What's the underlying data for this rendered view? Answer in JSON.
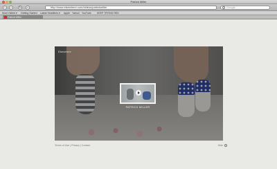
{
  "window": {
    "title": "Patrick Miller"
  },
  "toolbar": {
    "url": "http://www.elsewhere.com/videos/patrickmiller",
    "search_placeholder": "Google",
    "back": "‹",
    "forward": "›",
    "reload": "↻",
    "home": "⌂"
  },
  "bookmarks": {
    "items": [
      "Most Visited ▾",
      "Getting Started",
      "Latest Headlines ▾",
      "Apple",
      "Yahoo!",
      "YouTube",
      "KEEP TRYING RED"
    ]
  },
  "tab": {
    "label": "Patrick Miller"
  },
  "player": {
    "logo": "Elsewhere",
    "caption": "PATRICK MILLER"
  },
  "footer": {
    "links": [
      "Terms of Use",
      "Privacy",
      "Contact"
    ],
    "right": "Hide"
  },
  "colors": {
    "sock_blue": "#24388c",
    "sock_grey": "#585a5e",
    "page_bg": "#e9e9e6"
  }
}
